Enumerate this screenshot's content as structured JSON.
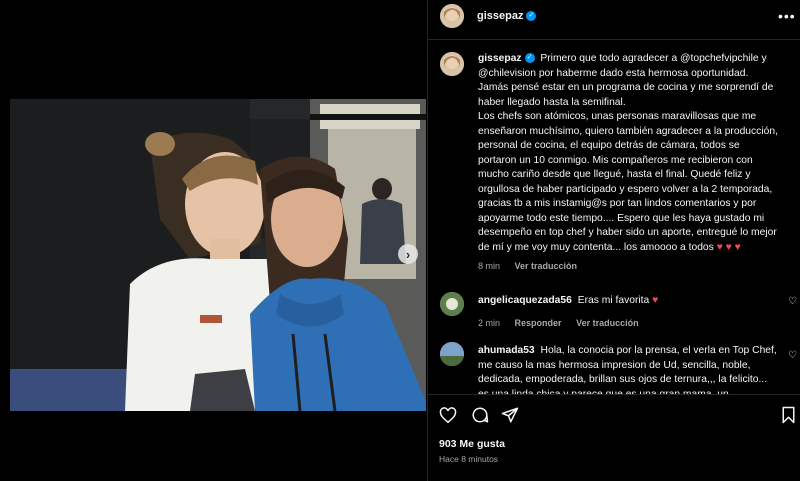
{
  "post": {
    "username": "gissepaz",
    "verified": true
  },
  "caption": {
    "username": "gissepaz",
    "text": "Primero que todo agradecer a @topchefvipchile y @chilevision por haberme dado esta hermosa oportunidad. Jamás pensé estar en un programa de cocina y me sorprendí de haber llegado hasta la semifinal.\nLos chefs son atómicos, unas personas maravillosas que me enseñaron muchísimo, quiero también agradecer a la producción, personal de cocina, el equipo detrás de cámara, todos se portaron un 10 conmigo. Mis compañeros me recibieron con mucho cariño desde que llegué, hasta el final. Quedé feliz y orgullosa de haber participado y espero volver a la 2 temporada, gracias tb a mis instamig@s por tan lindos comentarios y por apoyarme todo este tiempo.... Espero que les haya gustado mi desempeño en top chef y haber sido un aporte, entregué lo mejor de mí y me voy muy contenta... los amoooo a todos",
    "hearts": "♥ ♥ ♥",
    "time": "8 min",
    "translate": "Ver traducción"
  },
  "comments": [
    {
      "username": "angelicaquezada56",
      "text": "Eras mi favorita",
      "heart": "♥",
      "time": "2 min",
      "reply": "Responder",
      "translate": "Ver traducción"
    },
    {
      "username": "ahumada53",
      "text": "Hola, la conocia por la prensa, el verla en Top Chef, me causo la mas hermosa impresion de Ud, sencilla, noble, dedicada, empoderada, brillan sus ojos de ternura,,, la felicito... es una linda chica y parece que es una gran mama, un"
    }
  ],
  "actions": {
    "likes": "903 Me gusta",
    "time_ago": "Hace 8 minutos"
  },
  "icons": {
    "like": "heart-outline-icon",
    "comment": "comment-bubble-icon",
    "share": "paper-plane-icon",
    "save": "bookmark-icon",
    "more": "more-dots-icon",
    "next": "chevron-right-icon"
  },
  "colors": {
    "background": "#000000",
    "verified": "#0095f6",
    "heart": "#ed4956",
    "muted": "#a8a8a8"
  }
}
